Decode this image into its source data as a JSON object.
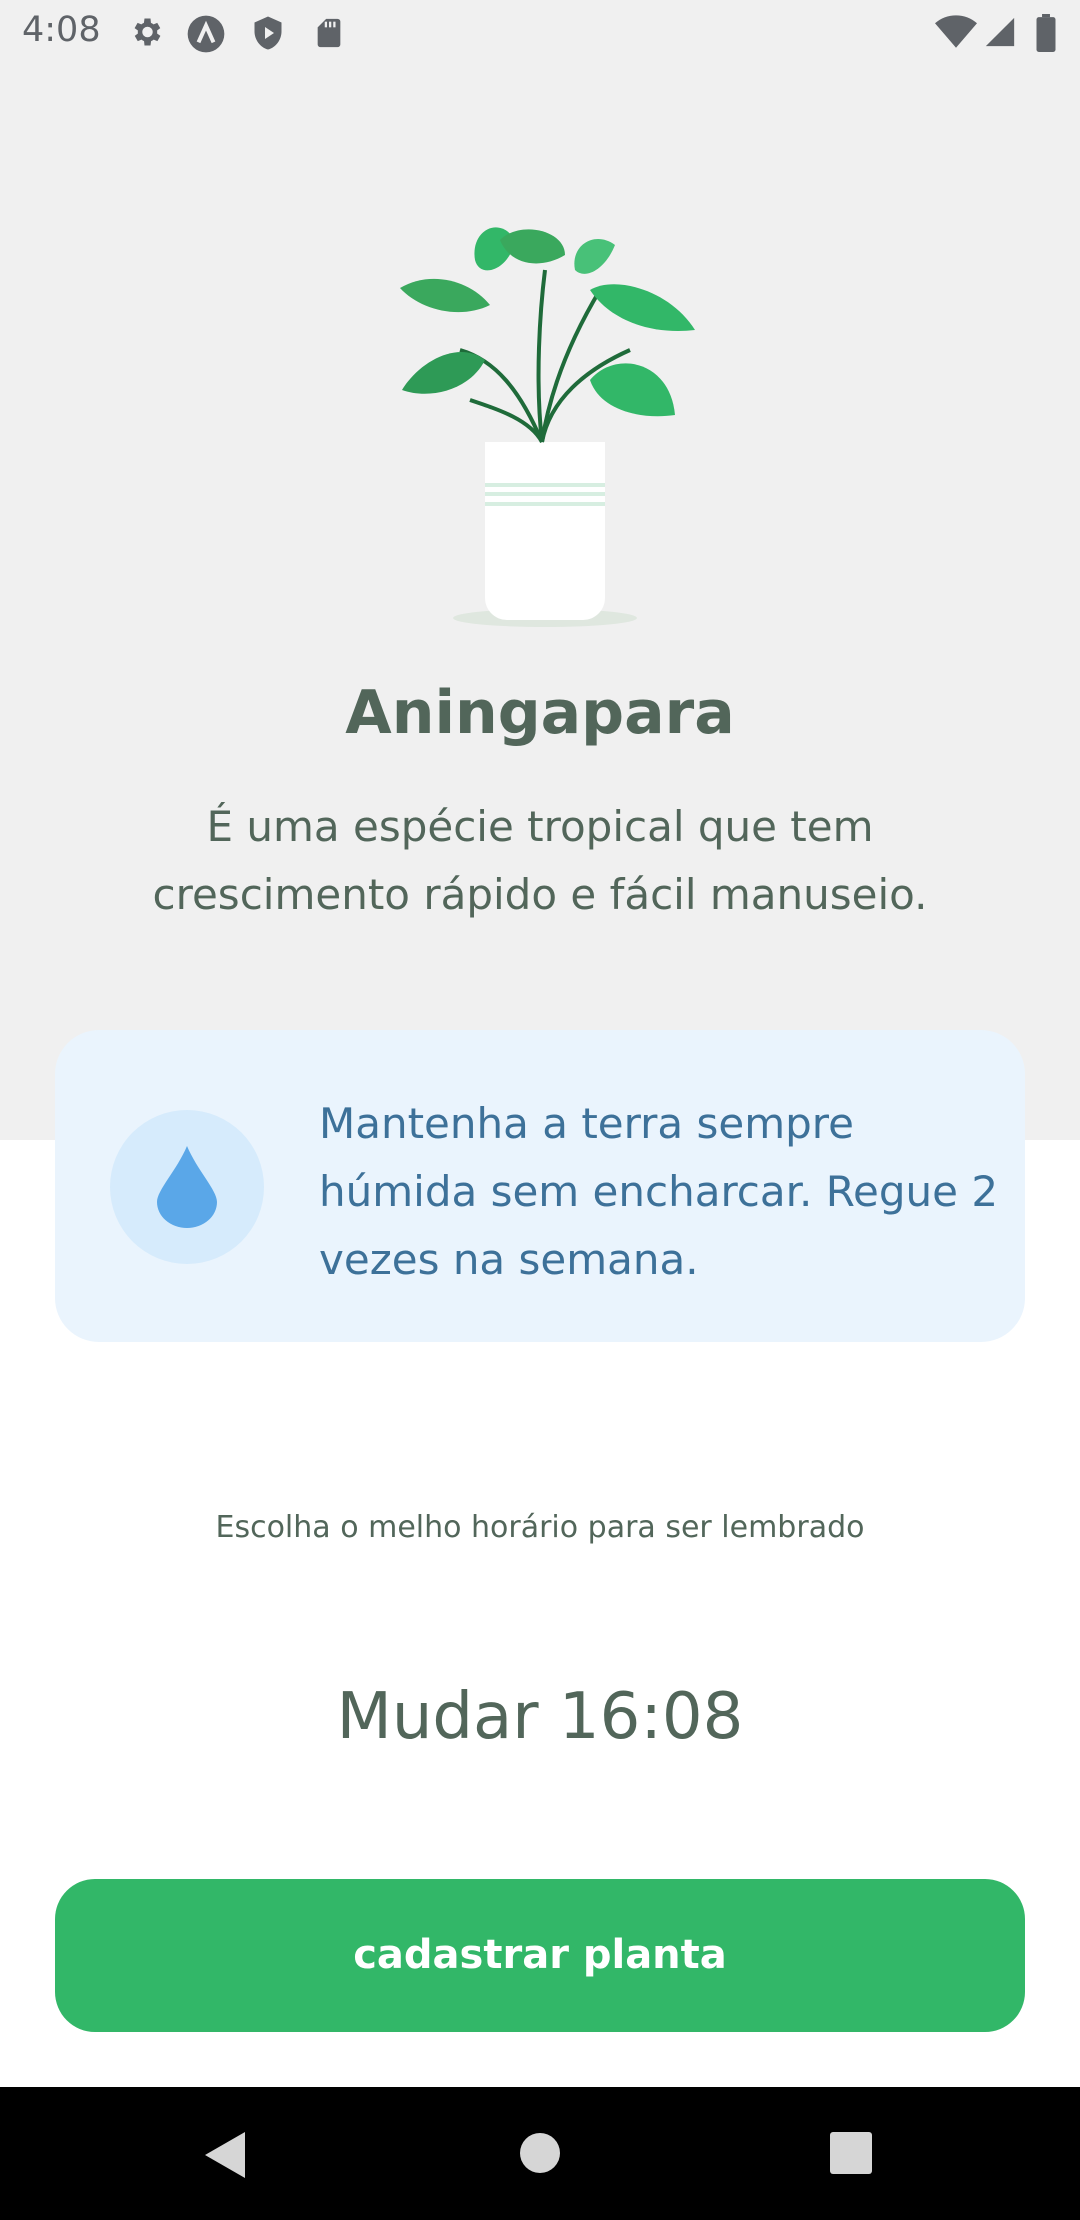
{
  "status_bar": {
    "time": "4:08",
    "left_icons": [
      "settings-icon",
      "app-a-icon",
      "shield-play-icon",
      "sd-card-icon"
    ],
    "right_icons": [
      "wifi-icon",
      "signal-icon",
      "battery-icon"
    ]
  },
  "plant": {
    "name": "Aningapara",
    "about": "É uma espécie tropical que tem crescimento rápido e fácil manuseio."
  },
  "tip": {
    "icon": "water-drop-icon",
    "text": "Mantenha a terra sempre húmida sem encharcar. Regue 2 vezes na semana."
  },
  "alert": {
    "label": "Escolha o melho horário para ser lembrado",
    "time_button": "Mudar 16:08"
  },
  "confirm_button": "cadastrar planta",
  "nav_bar": [
    "back-icon",
    "home-icon",
    "recents-icon"
  ],
  "colors": {
    "top_background": "#f0f0f0",
    "heading": "#52665a",
    "tip_background": "#eaf4fd",
    "tip_text": "#3d7199",
    "accent_green": "#32b768"
  }
}
